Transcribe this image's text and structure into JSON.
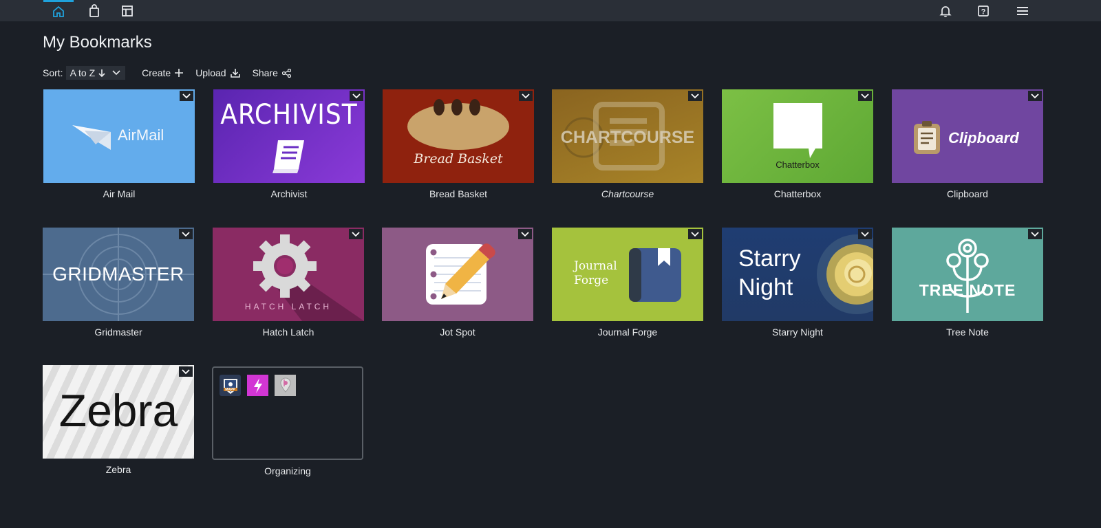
{
  "topbar": {
    "nav": [
      {
        "name": "home-icon",
        "active": true
      },
      {
        "name": "shopping-bag-icon",
        "active": false
      },
      {
        "name": "layout-icon",
        "active": false
      }
    ],
    "right": [
      "bell-icon",
      "help-icon",
      "hamburger-menu-icon"
    ],
    "accent": "#1fa2dc"
  },
  "page": {
    "title": "My Bookmarks"
  },
  "toolbar": {
    "sort_label": "Sort:",
    "sort_value": "A to Z",
    "create_label": "Create",
    "upload_label": "Upload",
    "share_label": "Share"
  },
  "tiles": [
    {
      "label": "Air Mail",
      "logo_text": "AirMail",
      "bg": "#63acec"
    },
    {
      "label": "Archivist",
      "logo_text": "ARCHIVIST",
      "bg": "#6b2fc4"
    },
    {
      "label": "Bread Basket",
      "logo_text": "Bread Basket",
      "bg": "#8f220e"
    },
    {
      "label": "Chartcourse",
      "logo_text": "CHARTCOURSE",
      "bg": "#a17725"
    },
    {
      "label": "Chatterbox",
      "logo_text": "Chatterbox",
      "bg": "#6eb43c"
    },
    {
      "label": "Clipboard",
      "logo_text": "Clipboard",
      "bg": "#7046a0"
    },
    {
      "label": "Gridmaster",
      "logo_text": "GRIDMASTER",
      "bg": "#4d6b8e"
    },
    {
      "label": "Hatch Latch",
      "logo_text": "HATCH LATCH",
      "bg": "#8a2b63"
    },
    {
      "label": "Jot Spot",
      "logo_text": "",
      "bg": "#8d5a86"
    },
    {
      "label": "Journal Forge",
      "logo_text": "Journal Forge",
      "bg": "#a5c23d"
    },
    {
      "label": "Starry Night",
      "logo_text": "Starry Night",
      "bg": "#223d6e"
    },
    {
      "label": "Tree Note",
      "logo_text": "TREE NOTE",
      "bg": "#5ea89c"
    },
    {
      "label": "Zebra",
      "logo_text": "Zebra",
      "bg": "#e9e9e9"
    }
  ],
  "folder": {
    "label": "Organizing",
    "items": [
      {
        "name": "mapp-app-icon",
        "text": "MAPP"
      },
      {
        "name": "bolt-app-icon",
        "text": ""
      },
      {
        "name": "pin-app-icon",
        "text": ""
      }
    ]
  }
}
